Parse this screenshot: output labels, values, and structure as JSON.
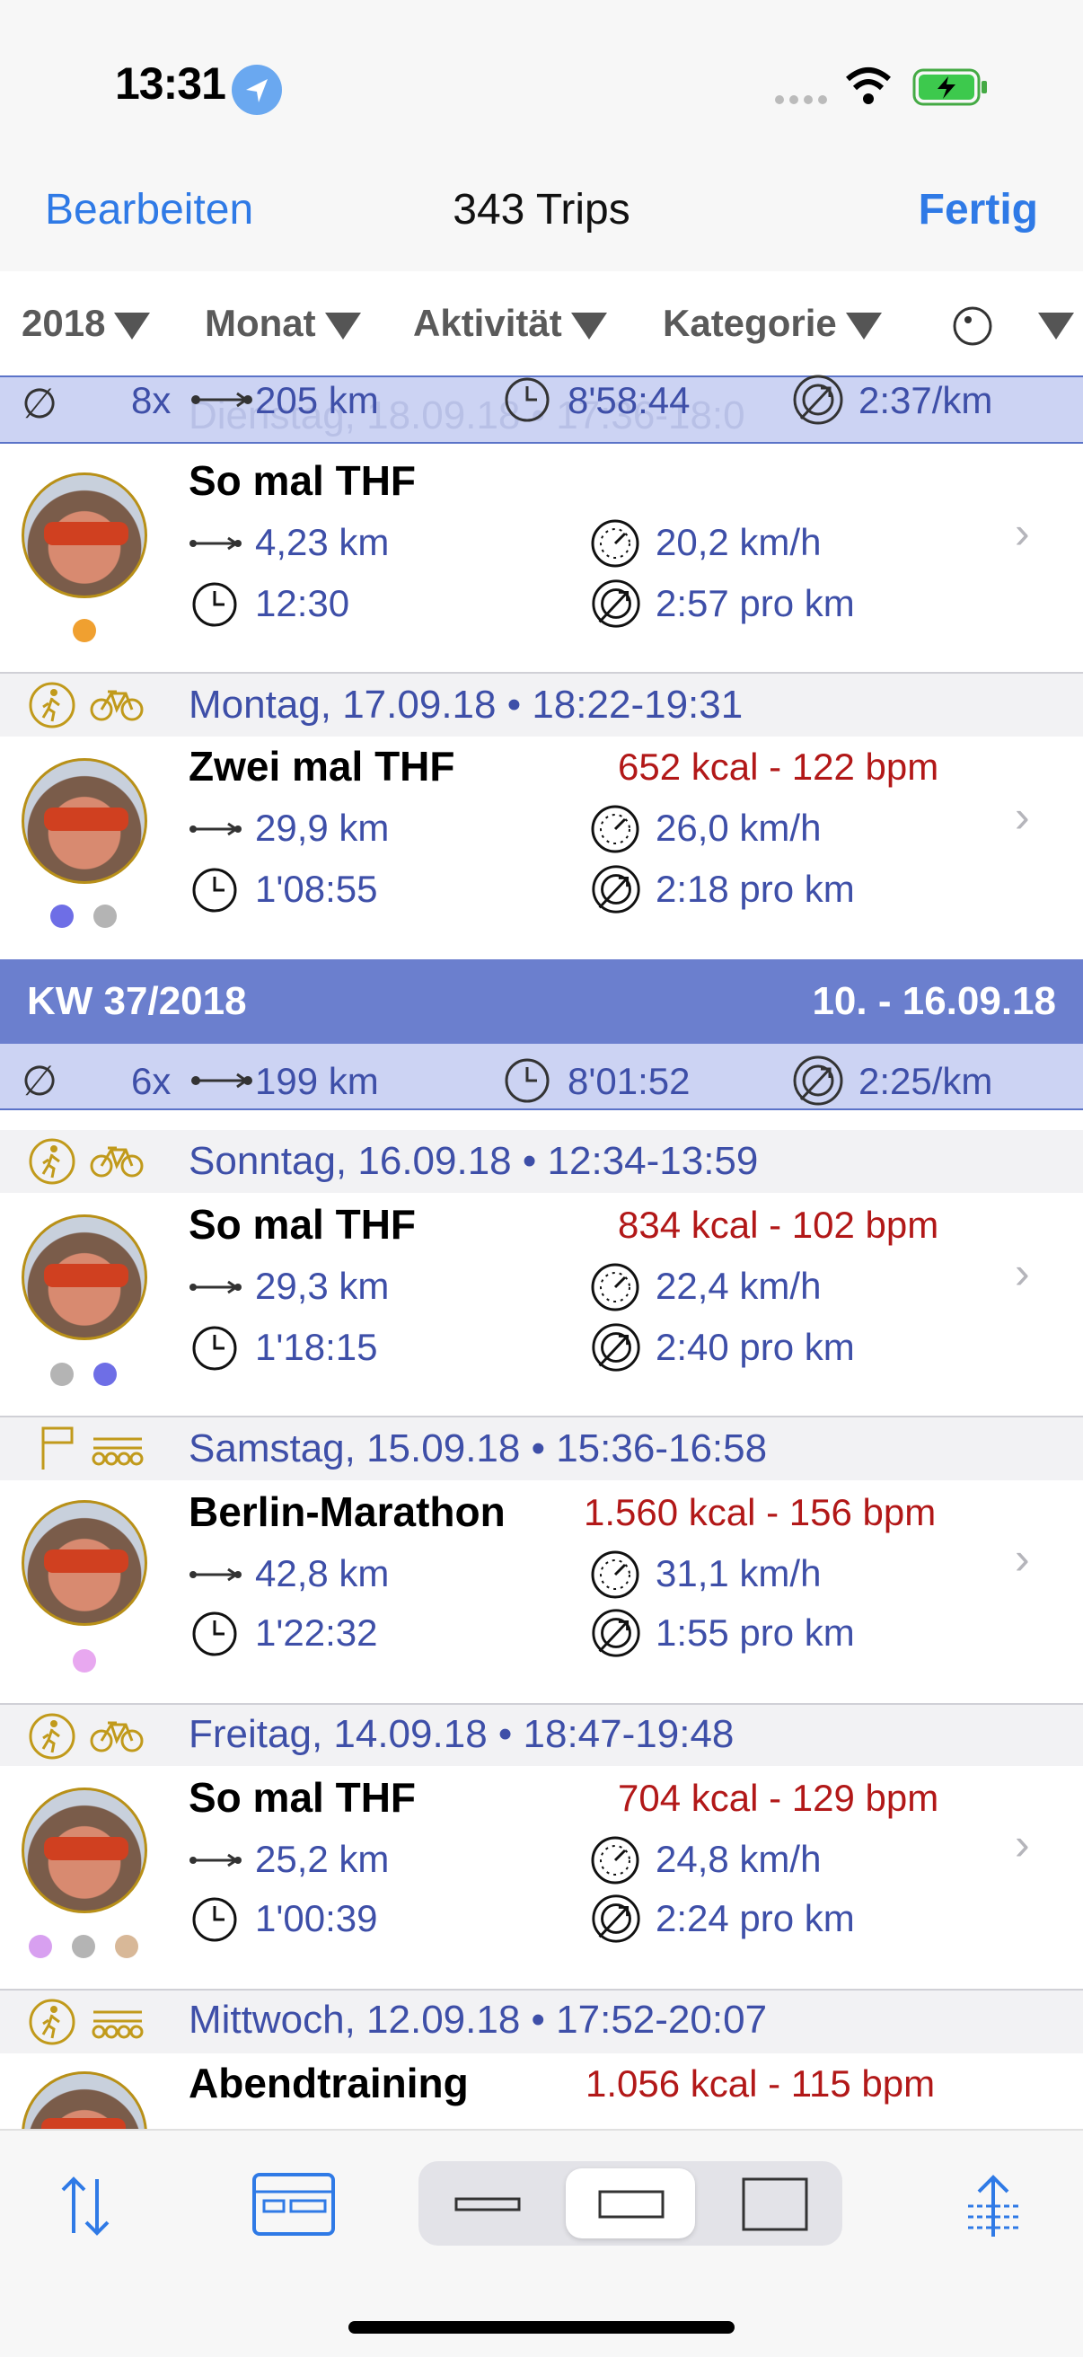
{
  "status": {
    "time": "13:31"
  },
  "nav": {
    "edit": "Bearbeiten",
    "title": "343 Trips",
    "done": "Fertig"
  },
  "filters": {
    "year": "2018",
    "month": "Monat",
    "activity": "Aktivität",
    "category": "Kategorie"
  },
  "summary_top": {
    "count": "8x",
    "distance": "205 km",
    "duration": "8'58:44",
    "pace": "2:37/km",
    "ghost_text": "Dienstag, 18.09.18 • 17:36-18:0"
  },
  "trips": [
    {
      "title": "So mal THF",
      "kcal": "",
      "distance": "4,23 km",
      "speed": "20,2 km/h",
      "duration": "12:30",
      "pace": "2:57 pro km",
      "dots": [
        "#f0a030"
      ]
    },
    {
      "date": "Montag, 17.09.18 • 18:22-19:31",
      "title": "Zwei mal THF",
      "kcal": "652 kcal - 122 bpm",
      "distance": "29,9 km",
      "speed": "26,0 km/h",
      "duration": "1'08:55",
      "pace": "2:18 pro km",
      "dots": [
        "#6e6ee6",
        "#b4b4b4"
      ]
    }
  ],
  "week": {
    "label": "KW 37/2018",
    "range": "10. - 16.09.18"
  },
  "summary_week": {
    "count": "6x",
    "distance": "199 km",
    "duration": "8'01:52",
    "pace": "2:25/km"
  },
  "week_trips": [
    {
      "date": "Sonntag, 16.09.18 • 12:34-13:59",
      "title": "So mal THF",
      "kcal": "834 kcal - 102 bpm",
      "distance": "29,3 km",
      "speed": "22,4 km/h",
      "duration": "1'18:15",
      "pace": "2:40 pro km",
      "dots": [
        "#b4b4b4",
        "#6e6ee6"
      ]
    },
    {
      "date": "Samstag, 15.09.18 • 15:36-16:58",
      "title": "Berlin-Marathon",
      "kcal": "1.560 kcal - 156 bpm",
      "distance": "42,8 km",
      "speed": "31,1 km/h",
      "duration": "1'22:32",
      "pace": "1:55 pro km",
      "dots": [
        "#e8a8f0"
      ]
    },
    {
      "date": "Freitag, 14.09.18 • 18:47-19:48",
      "title": "So mal THF",
      "kcal": "704 kcal - 129 bpm",
      "distance": "25,2 km",
      "speed": "24,8 km/h",
      "duration": "1'00:39",
      "pace": "2:24 pro km",
      "dots": [
        "#d8a0f0",
        "#b4b4b4",
        "#d8b898"
      ]
    },
    {
      "date": "Mittwoch, 12.09.18 • 17:52-20:07",
      "title": "Abendtraining",
      "kcal": "1.056 kcal - 115 bpm"
    }
  ]
}
